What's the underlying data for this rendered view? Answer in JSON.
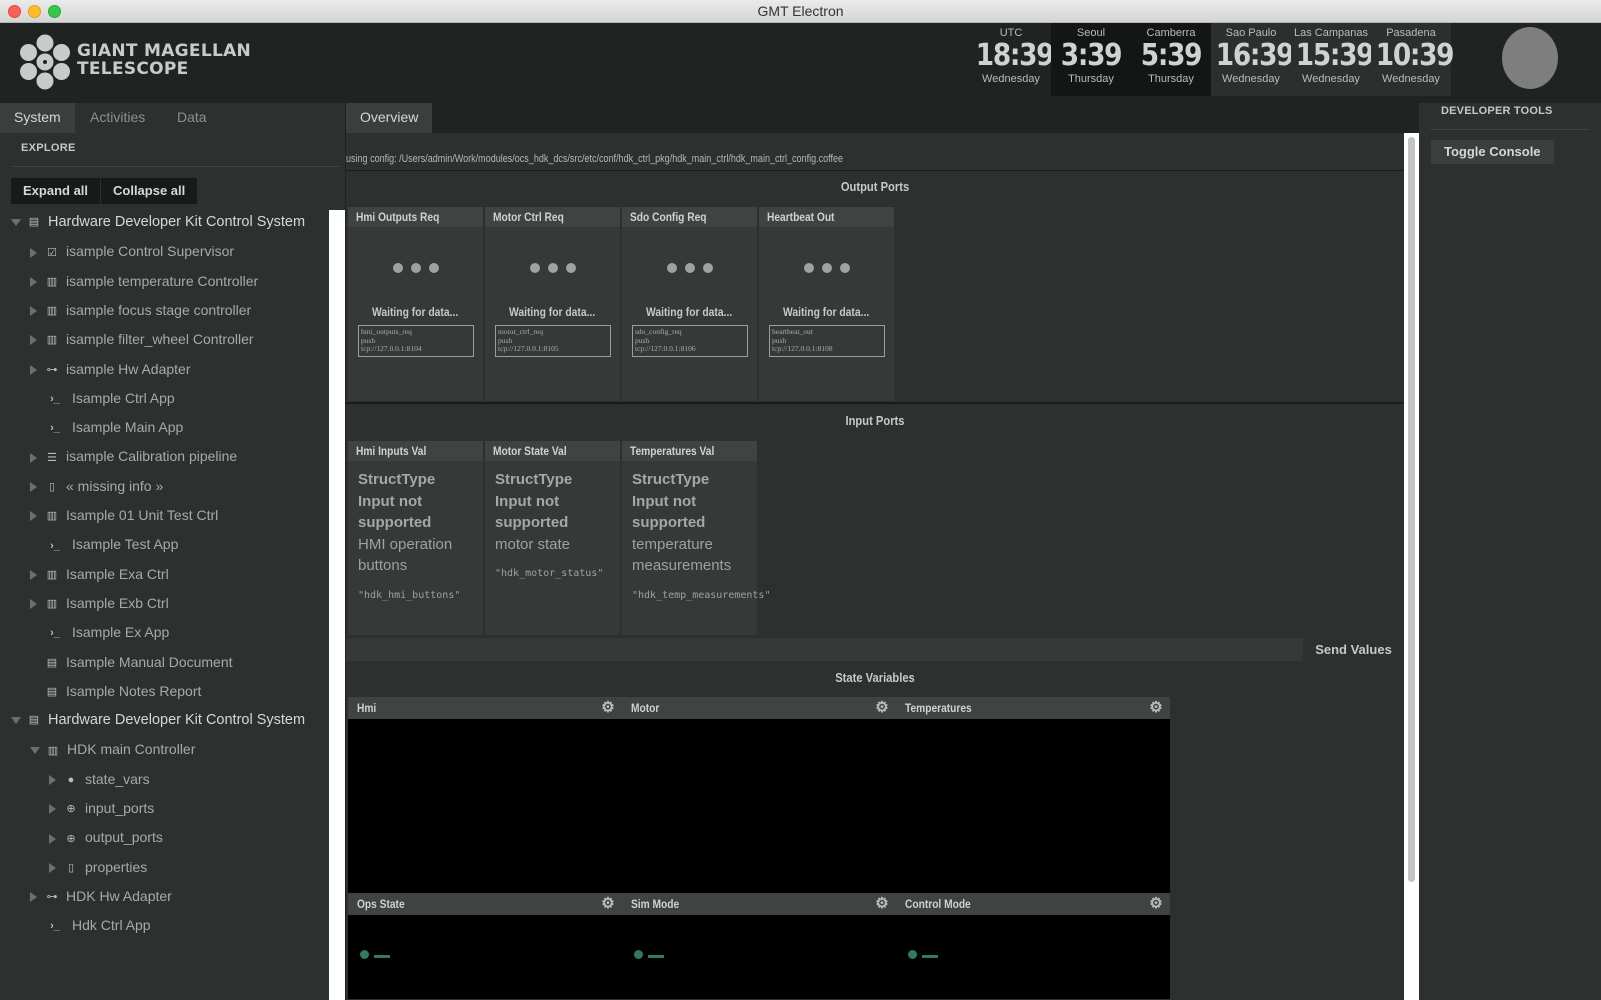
{
  "window": {
    "title": "GMT Electron"
  },
  "logo": {
    "text": "GIANT MAGELLAN\nTELESCOPE"
  },
  "clocks": [
    {
      "city": "UTC",
      "time": "18:39",
      "day": "Wednesday"
    },
    {
      "city": "Seoul",
      "time": "3:39",
      "day": "Thursday"
    },
    {
      "city": "Camberra",
      "time": "5:39",
      "day": "Thursday"
    },
    {
      "city": "Sao Paulo",
      "time": "16:39",
      "day": "Wednesday"
    },
    {
      "city": "Las Campanas",
      "time": "15:39",
      "day": "Wednesday"
    },
    {
      "city": "Pasadena",
      "time": "10:39",
      "day": "Wednesday"
    }
  ],
  "sidebar": {
    "tabs": [
      "System",
      "Activities",
      "Data"
    ],
    "section": "EXPLORE",
    "expand_label": "Expand all",
    "collapse_label": "Collapse all",
    "tree": [
      {
        "label": "Hardware Developer Kit Control System",
        "icon": "archive-icon"
      },
      {
        "label": "isample Control Supervisor",
        "icon": "checkbox-icon"
      },
      {
        "label": "isample temperature Controller",
        "icon": "chip-icon"
      },
      {
        "label": "isample focus stage controller",
        "icon": "chip-icon"
      },
      {
        "label": "isample filter_wheel Controller",
        "icon": "chip-icon"
      },
      {
        "label": "isample Hw Adapter",
        "icon": "network-icon"
      },
      {
        "label": "Isample Ctrl App",
        "icon": "terminal-icon"
      },
      {
        "label": "Isample Main App",
        "icon": "terminal-icon"
      },
      {
        "label": "isample Calibration pipeline",
        "icon": "list-icon"
      },
      {
        "label": "« missing info »",
        "icon": "file-icon"
      },
      {
        "label": "Isample 01 Unit Test Ctrl",
        "icon": "chip-icon"
      },
      {
        "label": "Isample Test App",
        "icon": "terminal-icon"
      },
      {
        "label": "Isample Exa Ctrl",
        "icon": "chip-icon"
      },
      {
        "label": "Isample Exb Ctrl",
        "icon": "chip-icon"
      },
      {
        "label": "Isample Ex App",
        "icon": "terminal-icon"
      },
      {
        "label": "Isample Manual Document",
        "icon": "document-icon"
      },
      {
        "label": "Isample Notes Report",
        "icon": "document-icon"
      },
      {
        "label": "Hardware Developer Kit Control System",
        "icon": "archive-icon"
      },
      {
        "label": "HDK main Controller",
        "icon": "chip-icon"
      },
      {
        "label": "state_vars",
        "icon": "state-icon"
      },
      {
        "label": "input_ports",
        "icon": "input-icon"
      },
      {
        "label": "output_ports",
        "icon": "output-icon"
      },
      {
        "label": "properties",
        "icon": "file-icon"
      },
      {
        "label": "HDK Hw Adapter",
        "icon": "network-icon"
      },
      {
        "label": "Hdk Ctrl App",
        "icon": "terminal-icon"
      }
    ]
  },
  "main": {
    "tab": "Overview",
    "config_path": "using config: /Users/admin/Work/modules/ocs_hdk_dcs/src/etc/conf/hdk_ctrl_pkg/hdk_main_ctrl/hdk_main_ctrl_config.coffee",
    "output_ports_title": "Output Ports",
    "output_ports": [
      {
        "name": "Hmi Outputs Req",
        "status": "Waiting for data...",
        "address": "hmi_outputs_req\npush\ntcp://127.0.0.1:8104"
      },
      {
        "name": "Motor Ctrl Req",
        "status": "Waiting for data...",
        "address": "motor_ctrl_req\npush\ntcp://127.0.0.1:8105"
      },
      {
        "name": "Sdo Config Req",
        "status": "Waiting for data...",
        "address": "sdo_config_req\npush\ntcp://127.0.0.1:8106"
      },
      {
        "name": "Heartbeat Out",
        "status": "Waiting for data...",
        "address": "heartbeat_out\npush\ntcp://127.0.0.1:8108"
      }
    ],
    "input_ports_title": "Input Ports",
    "input_ports": [
      {
        "name": "Hmi Inputs Val",
        "msg1": "StructType",
        "msg2": "Input not supported",
        "desc": "HMI operation buttons",
        "type": "\"hdk_hmi_buttons\""
      },
      {
        "name": "Motor State Val",
        "msg1": "StructType",
        "msg2": "Input not supported",
        "desc": "motor state",
        "type": "\"hdk_motor_status\""
      },
      {
        "name": "Temperatures Val",
        "msg1": "StructType",
        "msg2": "Input not supported",
        "desc": "temperature measurements",
        "type": "\"hdk_temp_measurements\""
      }
    ],
    "send_label": "Send Values",
    "state_vars_title": "State Variables",
    "state_vars": [
      "Hmi",
      "Motor",
      "Temperatures",
      "Ops State",
      "Sim Mode",
      "Control Mode"
    ]
  },
  "devtools": {
    "title": "DEVELOPER TOOLS",
    "toggle_label": "Toggle Console"
  },
  "colors": {
    "accent_green": "#2f7a66",
    "panel": "#2c302e",
    "background": "#1f2321"
  }
}
